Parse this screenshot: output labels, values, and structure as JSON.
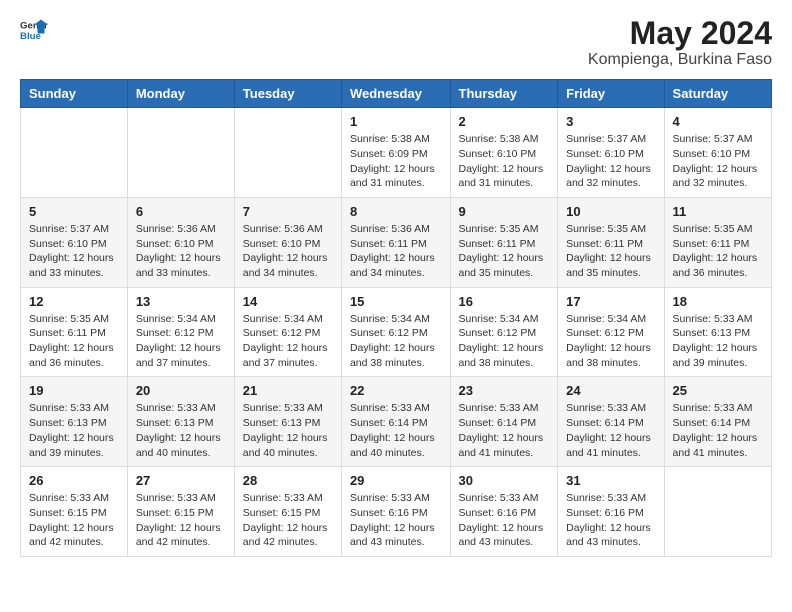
{
  "logo": {
    "general": "General",
    "blue": "Blue"
  },
  "title": "May 2024",
  "subtitle": "Kompienga, Burkina Faso",
  "weekdays": [
    "Sunday",
    "Monday",
    "Tuesday",
    "Wednesday",
    "Thursday",
    "Friday",
    "Saturday"
  ],
  "weeks": [
    [
      {
        "day": "",
        "sunrise": "",
        "sunset": "",
        "daylight": ""
      },
      {
        "day": "",
        "sunrise": "",
        "sunset": "",
        "daylight": ""
      },
      {
        "day": "",
        "sunrise": "",
        "sunset": "",
        "daylight": ""
      },
      {
        "day": "1",
        "sunrise": "Sunrise: 5:38 AM",
        "sunset": "Sunset: 6:09 PM",
        "daylight": "Daylight: 12 hours and 31 minutes."
      },
      {
        "day": "2",
        "sunrise": "Sunrise: 5:38 AM",
        "sunset": "Sunset: 6:10 PM",
        "daylight": "Daylight: 12 hours and 31 minutes."
      },
      {
        "day": "3",
        "sunrise": "Sunrise: 5:37 AM",
        "sunset": "Sunset: 6:10 PM",
        "daylight": "Daylight: 12 hours and 32 minutes."
      },
      {
        "day": "4",
        "sunrise": "Sunrise: 5:37 AM",
        "sunset": "Sunset: 6:10 PM",
        "daylight": "Daylight: 12 hours and 32 minutes."
      }
    ],
    [
      {
        "day": "5",
        "sunrise": "Sunrise: 5:37 AM",
        "sunset": "Sunset: 6:10 PM",
        "daylight": "Daylight: 12 hours and 33 minutes."
      },
      {
        "day": "6",
        "sunrise": "Sunrise: 5:36 AM",
        "sunset": "Sunset: 6:10 PM",
        "daylight": "Daylight: 12 hours and 33 minutes."
      },
      {
        "day": "7",
        "sunrise": "Sunrise: 5:36 AM",
        "sunset": "Sunset: 6:10 PM",
        "daylight": "Daylight: 12 hours and 34 minutes."
      },
      {
        "day": "8",
        "sunrise": "Sunrise: 5:36 AM",
        "sunset": "Sunset: 6:11 PM",
        "daylight": "Daylight: 12 hours and 34 minutes."
      },
      {
        "day": "9",
        "sunrise": "Sunrise: 5:35 AM",
        "sunset": "Sunset: 6:11 PM",
        "daylight": "Daylight: 12 hours and 35 minutes."
      },
      {
        "day": "10",
        "sunrise": "Sunrise: 5:35 AM",
        "sunset": "Sunset: 6:11 PM",
        "daylight": "Daylight: 12 hours and 35 minutes."
      },
      {
        "day": "11",
        "sunrise": "Sunrise: 5:35 AM",
        "sunset": "Sunset: 6:11 PM",
        "daylight": "Daylight: 12 hours and 36 minutes."
      }
    ],
    [
      {
        "day": "12",
        "sunrise": "Sunrise: 5:35 AM",
        "sunset": "Sunset: 6:11 PM",
        "daylight": "Daylight: 12 hours and 36 minutes."
      },
      {
        "day": "13",
        "sunrise": "Sunrise: 5:34 AM",
        "sunset": "Sunset: 6:12 PM",
        "daylight": "Daylight: 12 hours and 37 minutes."
      },
      {
        "day": "14",
        "sunrise": "Sunrise: 5:34 AM",
        "sunset": "Sunset: 6:12 PM",
        "daylight": "Daylight: 12 hours and 37 minutes."
      },
      {
        "day": "15",
        "sunrise": "Sunrise: 5:34 AM",
        "sunset": "Sunset: 6:12 PM",
        "daylight": "Daylight: 12 hours and 38 minutes."
      },
      {
        "day": "16",
        "sunrise": "Sunrise: 5:34 AM",
        "sunset": "Sunset: 6:12 PM",
        "daylight": "Daylight: 12 hours and 38 minutes."
      },
      {
        "day": "17",
        "sunrise": "Sunrise: 5:34 AM",
        "sunset": "Sunset: 6:12 PM",
        "daylight": "Daylight: 12 hours and 38 minutes."
      },
      {
        "day": "18",
        "sunrise": "Sunrise: 5:33 AM",
        "sunset": "Sunset: 6:13 PM",
        "daylight": "Daylight: 12 hours and 39 minutes."
      }
    ],
    [
      {
        "day": "19",
        "sunrise": "Sunrise: 5:33 AM",
        "sunset": "Sunset: 6:13 PM",
        "daylight": "Daylight: 12 hours and 39 minutes."
      },
      {
        "day": "20",
        "sunrise": "Sunrise: 5:33 AM",
        "sunset": "Sunset: 6:13 PM",
        "daylight": "Daylight: 12 hours and 40 minutes."
      },
      {
        "day": "21",
        "sunrise": "Sunrise: 5:33 AM",
        "sunset": "Sunset: 6:13 PM",
        "daylight": "Daylight: 12 hours and 40 minutes."
      },
      {
        "day": "22",
        "sunrise": "Sunrise: 5:33 AM",
        "sunset": "Sunset: 6:14 PM",
        "daylight": "Daylight: 12 hours and 40 minutes."
      },
      {
        "day": "23",
        "sunrise": "Sunrise: 5:33 AM",
        "sunset": "Sunset: 6:14 PM",
        "daylight": "Daylight: 12 hours and 41 minutes."
      },
      {
        "day": "24",
        "sunrise": "Sunrise: 5:33 AM",
        "sunset": "Sunset: 6:14 PM",
        "daylight": "Daylight: 12 hours and 41 minutes."
      },
      {
        "day": "25",
        "sunrise": "Sunrise: 5:33 AM",
        "sunset": "Sunset: 6:14 PM",
        "daylight": "Daylight: 12 hours and 41 minutes."
      }
    ],
    [
      {
        "day": "26",
        "sunrise": "Sunrise: 5:33 AM",
        "sunset": "Sunset: 6:15 PM",
        "daylight": "Daylight: 12 hours and 42 minutes."
      },
      {
        "day": "27",
        "sunrise": "Sunrise: 5:33 AM",
        "sunset": "Sunset: 6:15 PM",
        "daylight": "Daylight: 12 hours and 42 minutes."
      },
      {
        "day": "28",
        "sunrise": "Sunrise: 5:33 AM",
        "sunset": "Sunset: 6:15 PM",
        "daylight": "Daylight: 12 hours and 42 minutes."
      },
      {
        "day": "29",
        "sunrise": "Sunrise: 5:33 AM",
        "sunset": "Sunset: 6:16 PM",
        "daylight": "Daylight: 12 hours and 43 minutes."
      },
      {
        "day": "30",
        "sunrise": "Sunrise: 5:33 AM",
        "sunset": "Sunset: 6:16 PM",
        "daylight": "Daylight: 12 hours and 43 minutes."
      },
      {
        "day": "31",
        "sunrise": "Sunrise: 5:33 AM",
        "sunset": "Sunset: 6:16 PM",
        "daylight": "Daylight: 12 hours and 43 minutes."
      },
      {
        "day": "",
        "sunrise": "",
        "sunset": "",
        "daylight": ""
      }
    ]
  ]
}
